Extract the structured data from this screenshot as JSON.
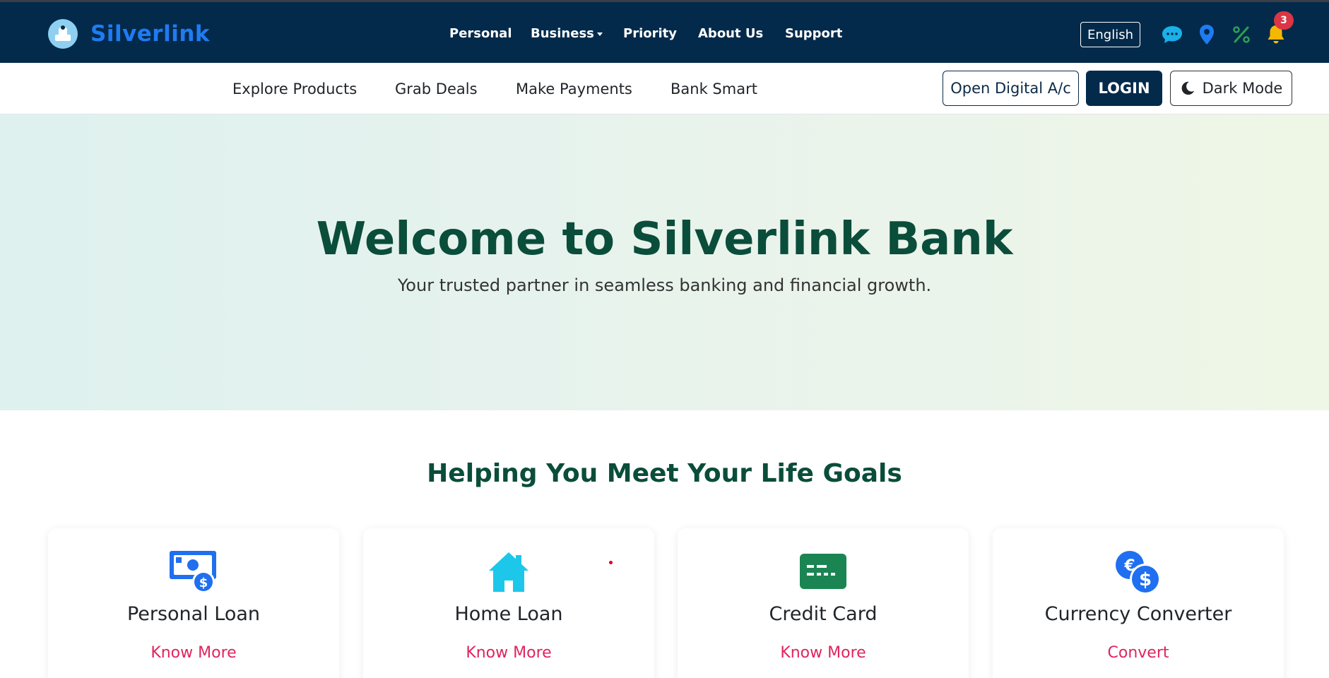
{
  "brand": {
    "name": "Silverlink"
  },
  "main_nav": {
    "items": [
      {
        "label": "Personal"
      },
      {
        "label": "Business"
      },
      {
        "label": "Priority"
      },
      {
        "label": "About Us"
      },
      {
        "label": "Support"
      }
    ]
  },
  "top_actions": {
    "language": "English",
    "notification_count": "3",
    "icons": [
      "chat-icon",
      "location-icon",
      "percent-icon",
      "bell-icon"
    ]
  },
  "sub_nav": {
    "items": [
      {
        "label": "Explore Products"
      },
      {
        "label": "Grab Deals"
      },
      {
        "label": "Make Payments"
      },
      {
        "label": "Bank Smart"
      }
    ],
    "open_account": "Open Digital A/c",
    "login": "LOGIN",
    "dark_mode": "Dark Mode"
  },
  "hero": {
    "title": "Welcome to Silverlink Bank",
    "subtitle": "Your trusted partner in seamless banking and financial growth."
  },
  "goals": {
    "title": "Helping You Meet Your Life Goals",
    "cards": [
      {
        "title": "Personal Loan",
        "link": "Know More",
        "icon": "money-icon"
      },
      {
        "title": "Home Loan",
        "link": "Know More",
        "icon": "house-icon"
      },
      {
        "title": "Credit Card",
        "link": "Know More",
        "icon": "credit-card-icon"
      },
      {
        "title": "Currency Converter",
        "link": "Convert",
        "icon": "currency-exchange-icon"
      }
    ]
  },
  "colors": {
    "navbar": "#032a4b",
    "brand": "#1f7bf2",
    "heading": "#0a4d3a",
    "link": "#e0245e",
    "badge": "#dc3545"
  }
}
